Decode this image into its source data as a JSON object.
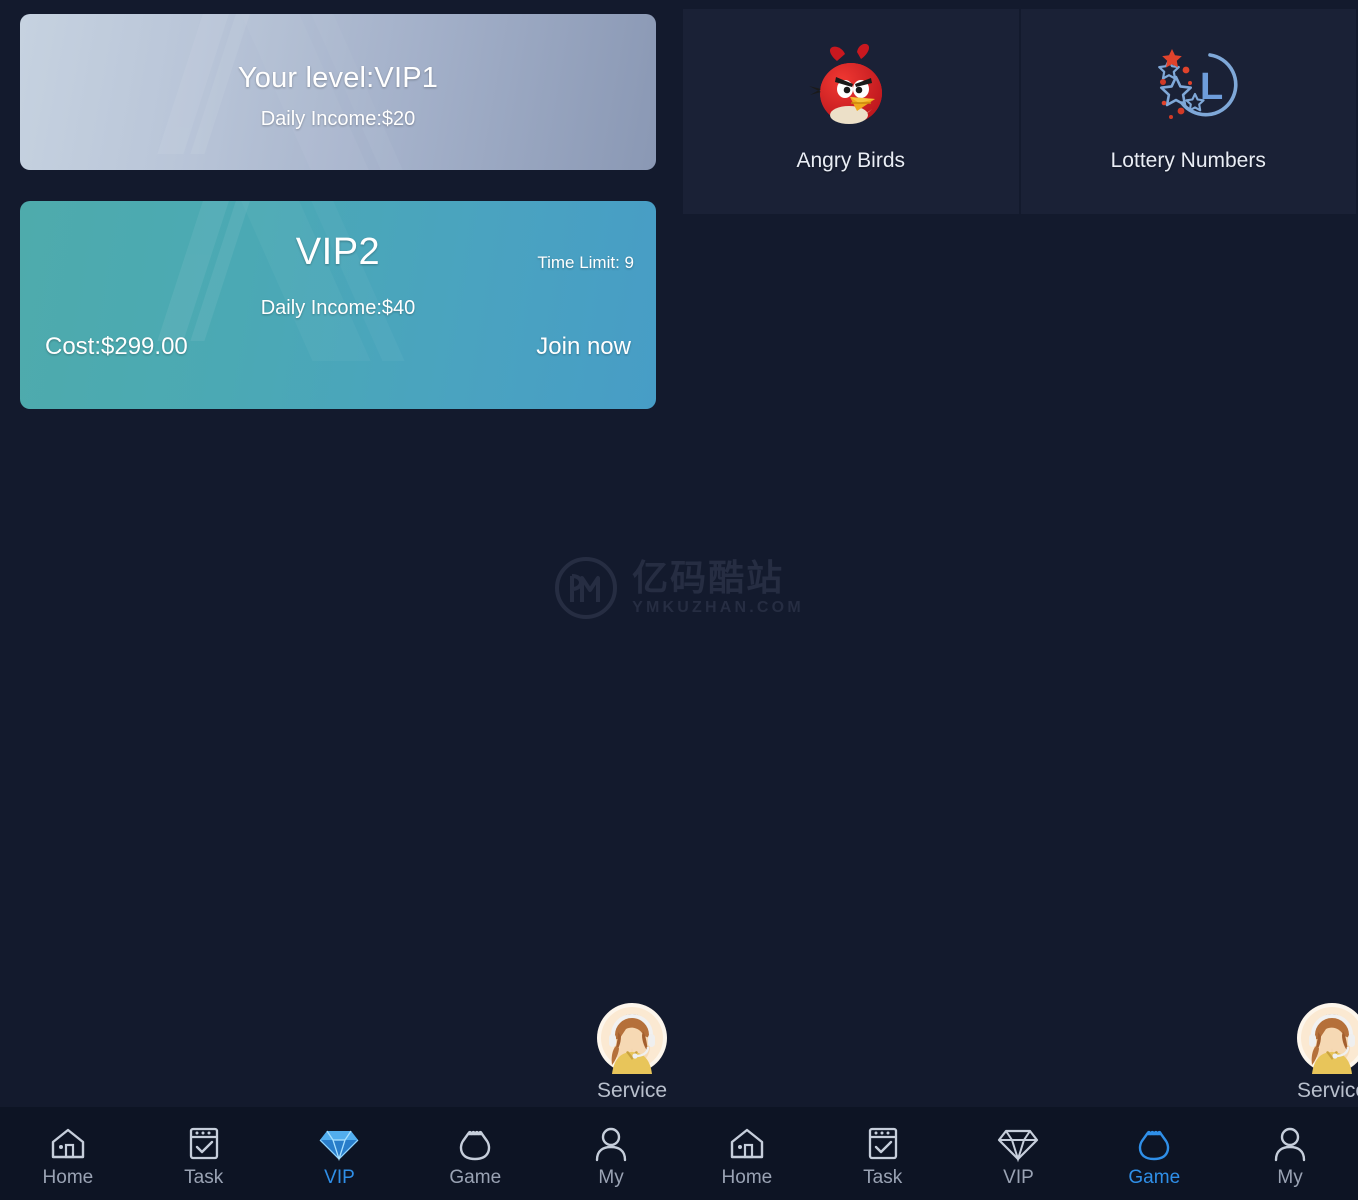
{
  "theme": {
    "page_bg": "#131a2d",
    "tile_bg": "#1a2136",
    "navbar_bg": "#0d1424",
    "accent_active": "#2f8fe8",
    "vip1_gradient_from": "#c6d2e0",
    "vip1_gradient_to": "#8a98b4",
    "vip2_gradient_from": "#4eabac",
    "vip2_gradient_to": "#479dc6",
    "label_muted": "#9aa3b4",
    "watermark_color": "#262d42"
  },
  "vip": {
    "current": {
      "title": "Your level:VIP1",
      "daily_income": "Daily Income:$20"
    },
    "offer": {
      "title": "VIP2",
      "time_limit": "Time Limit: 9",
      "daily_income": "Daily Income:$40",
      "cost": "Cost:$299.00",
      "join_label": "Join now"
    }
  },
  "games": [
    {
      "label": "Angry Birds",
      "icon": "angry-birds-icon"
    },
    {
      "label": "Lottery Numbers",
      "icon": "lottery-numbers-icon"
    }
  ],
  "watermark": {
    "cn": "亿码酷站",
    "en": "YMKUZHAN.COM",
    "logo_icon": "ym-logo-icon"
  },
  "service": {
    "label": "Service",
    "icon": "headset-agent-avatar"
  },
  "navbars": [
    {
      "name": "left",
      "items": [
        {
          "label": "Home",
          "icon": "home-icon",
          "active": false
        },
        {
          "label": "Task",
          "icon": "task-icon",
          "active": false
        },
        {
          "label": "VIP",
          "icon": "diamond-icon",
          "active": true
        },
        {
          "label": "Game",
          "icon": "purse-icon",
          "active": false
        },
        {
          "label": "My",
          "icon": "person-icon",
          "active": false
        }
      ]
    },
    {
      "name": "right",
      "items": [
        {
          "label": "Home",
          "icon": "home-icon",
          "active": false
        },
        {
          "label": "Task",
          "icon": "task-icon",
          "active": false
        },
        {
          "label": "VIP",
          "icon": "diamond-icon",
          "active": false
        },
        {
          "label": "Game",
          "icon": "purse-icon",
          "active": true
        },
        {
          "label": "My",
          "icon": "person-icon",
          "active": false
        }
      ]
    }
  ]
}
